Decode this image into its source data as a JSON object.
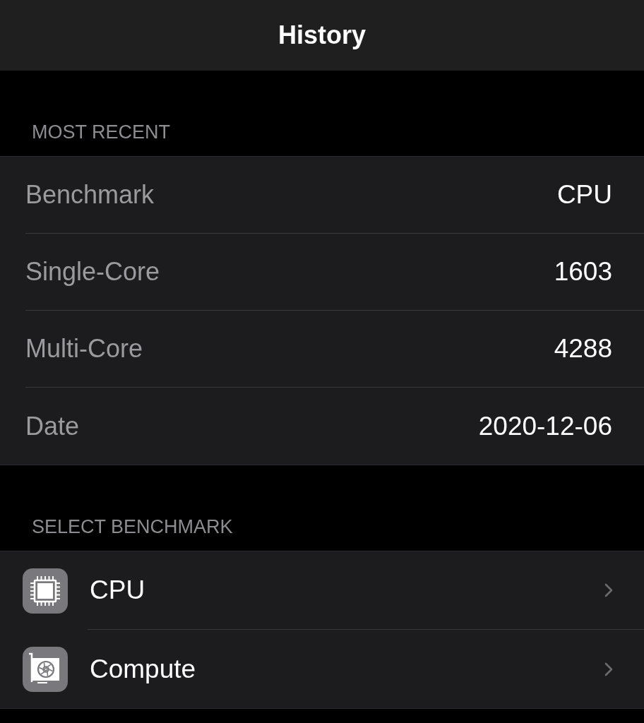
{
  "nav_bar": {
    "title": "History"
  },
  "sections": [
    {
      "header": "MOST RECENT",
      "kind": "details",
      "rows": [
        {
          "label": "Benchmark",
          "value": "CPU"
        },
        {
          "label": "Single-Core",
          "value": "1603"
        },
        {
          "label": "Multi-Core",
          "value": "4288"
        },
        {
          "label": "Date",
          "value": "2020-12-06"
        }
      ]
    },
    {
      "header": "SELECT BENCHMARK",
      "kind": "links",
      "rows": [
        {
          "label": "CPU",
          "kind": "cpu"
        },
        {
          "label": "Compute",
          "kind": "gpu"
        }
      ]
    }
  ]
}
